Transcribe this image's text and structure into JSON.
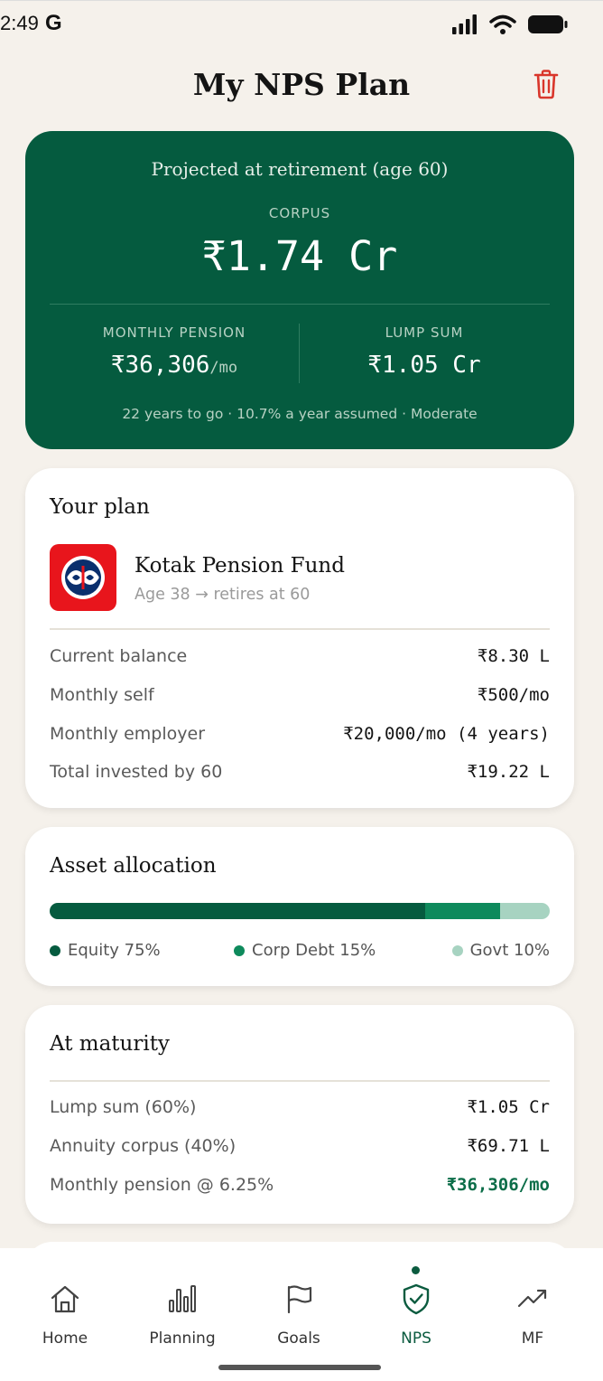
{
  "status_bar": {
    "time": "2:49",
    "carrier_icon": "G"
  },
  "header": {
    "title": "My NPS Plan"
  },
  "projection": {
    "heading": "Projected at retirement (age 60)",
    "corpus_label": "CORPUS",
    "corpus_value": "₹1.74 Cr",
    "monthly_pension_label": "MONTHLY PENSION",
    "monthly_pension_value": "₹36,306",
    "monthly_pension_unit": "/mo",
    "lump_sum_label": "LUMP SUM",
    "lump_sum_value": "₹1.05 Cr",
    "footer": "22 years to go · 10.7% a year assumed · Moderate"
  },
  "plan": {
    "title": "Your plan",
    "fund_name": "Kotak Pension Fund",
    "fund_sub": "Age 38 → retires at 60",
    "rows": [
      {
        "label": "Current balance",
        "value": "₹8.30 L"
      },
      {
        "label": "Monthly self",
        "value": "₹500/mo"
      },
      {
        "label": "Monthly employer",
        "value": "₹20,000/mo (4 years)"
      },
      {
        "label": "Total invested by 60",
        "value": "₹19.22 L"
      }
    ]
  },
  "allocation": {
    "title": "Asset allocation",
    "segments": [
      {
        "label": "Equity 75%",
        "percent": 75,
        "color": "#055b3f"
      },
      {
        "label": "Corp Debt 15%",
        "percent": 15,
        "color": "#0e8a5c"
      },
      {
        "label": "Govt 10%",
        "percent": 10,
        "color": "#a7d3c1"
      }
    ]
  },
  "maturity": {
    "title": "At maturity",
    "rows": [
      {
        "label": "Lump sum (60%)",
        "value": "₹1.05 Cr"
      },
      {
        "label": "Annuity corpus (40%)",
        "value": "₹69.71 L"
      },
      {
        "label": "Monthly pension @ 6.25%",
        "value": "₹36,306/mo"
      }
    ]
  },
  "nav": {
    "items": [
      {
        "label": "Home",
        "icon": "home-icon"
      },
      {
        "label": "Planning",
        "icon": "bar-chart-icon"
      },
      {
        "label": "Goals",
        "icon": "flag-icon"
      },
      {
        "label": "NPS",
        "icon": "shield-check-icon"
      },
      {
        "label": "MF",
        "icon": "trend-up-icon"
      }
    ],
    "active": "NPS"
  },
  "colors": {
    "brand_green": "#055b3f",
    "danger": "#d9362b",
    "background": "#f5f1eb"
  }
}
